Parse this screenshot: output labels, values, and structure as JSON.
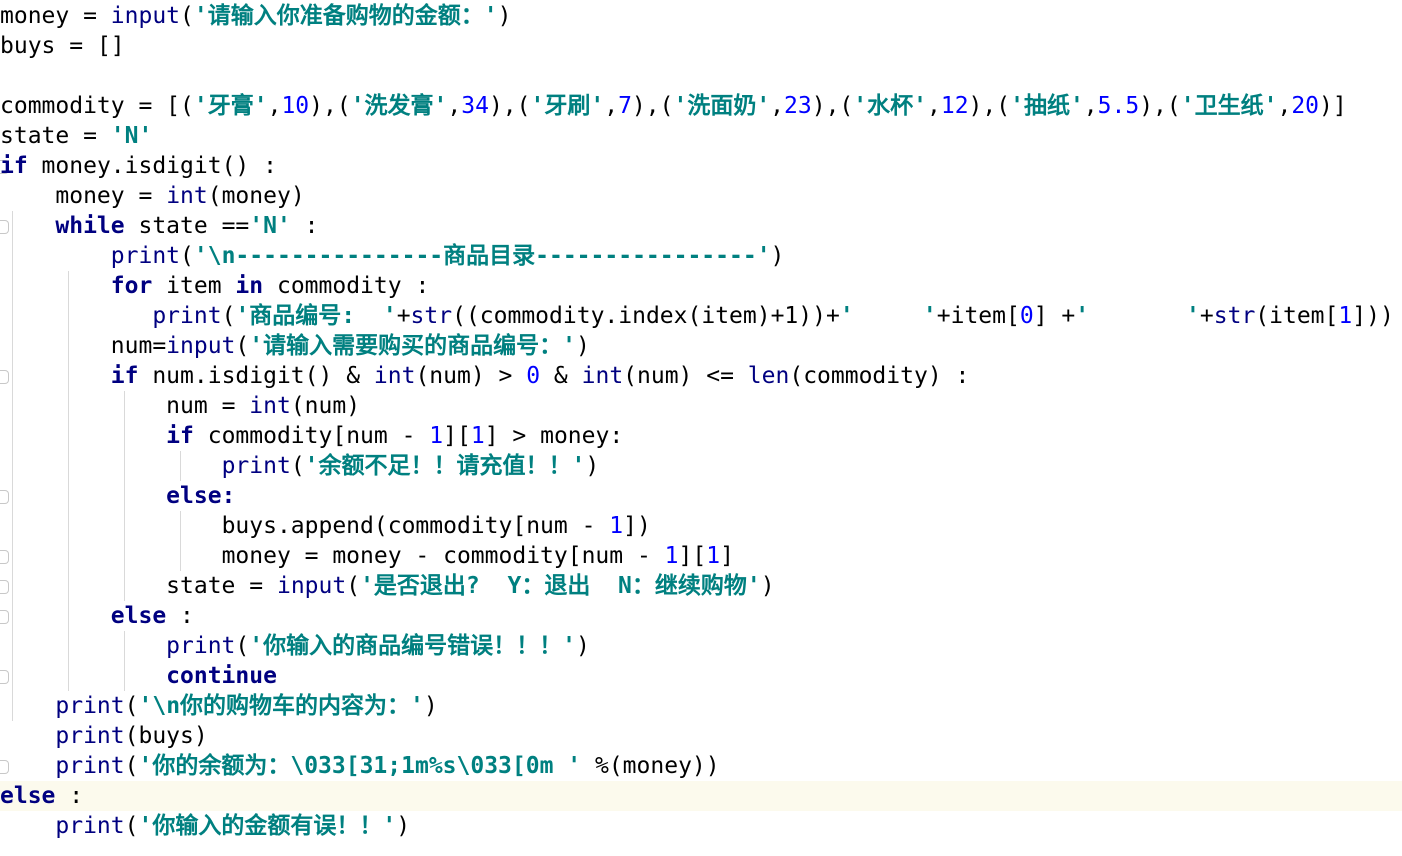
{
  "editor": {
    "language": "python",
    "current_line": 26,
    "colors": {
      "background": "#ffffff",
      "keyword": "#000080",
      "string": "#008080",
      "number": "#0000ff",
      "builtin": "#000080",
      "current_line": "#fcfaed",
      "indent_guide": "#d9d9d9"
    },
    "lines": [
      [
        [
          "id",
          "money"
        ],
        [
          "op",
          " = "
        ],
        [
          "bi",
          "input"
        ],
        [
          "op",
          "("
        ],
        [
          "str",
          "'请输入你准备购物的金额：'"
        ],
        [
          "op",
          ")"
        ]
      ],
      [
        [
          "id",
          "buys"
        ],
        [
          "op",
          " = "
        ],
        [
          "op",
          "[]"
        ]
      ],
      [],
      [
        [
          "id",
          "commodity"
        ],
        [
          "op",
          " = "
        ],
        [
          "op",
          "[("
        ],
        [
          "str",
          "'牙膏'"
        ],
        [
          "op",
          ","
        ],
        [
          "num",
          "10"
        ],
        [
          "op",
          "),("
        ],
        [
          "str",
          "'洗发膏'"
        ],
        [
          "op",
          ","
        ],
        [
          "num",
          "34"
        ],
        [
          "op",
          "),("
        ],
        [
          "str",
          "'牙刷'"
        ],
        [
          "op",
          ","
        ],
        [
          "num",
          "7"
        ],
        [
          "op",
          "),("
        ],
        [
          "str",
          "'洗面奶'"
        ],
        [
          "op",
          ","
        ],
        [
          "num",
          "23"
        ],
        [
          "op",
          "),("
        ],
        [
          "str",
          "'水杯'"
        ],
        [
          "op",
          ","
        ],
        [
          "num",
          "12"
        ],
        [
          "op",
          "),("
        ],
        [
          "str",
          "'抽纸'"
        ],
        [
          "op",
          ","
        ],
        [
          "num",
          "5.5"
        ],
        [
          "op",
          "),("
        ],
        [
          "str",
          "'卫生纸'"
        ],
        [
          "op",
          ","
        ],
        [
          "num",
          "20"
        ],
        [
          "op",
          ")]"
        ]
      ],
      [
        [
          "id",
          "state"
        ],
        [
          "op",
          " = "
        ],
        [
          "str",
          "'N'"
        ]
      ],
      [
        [
          "kw",
          "if"
        ],
        [
          "id",
          " money.isdigit() :"
        ]
      ],
      [
        [
          "ws",
          "    "
        ],
        [
          "id",
          "money"
        ],
        [
          "op",
          " = "
        ],
        [
          "bi",
          "int"
        ],
        [
          "op",
          "(money)"
        ]
      ],
      [
        [
          "ws",
          "    "
        ],
        [
          "kw",
          "while"
        ],
        [
          "id",
          " state =="
        ],
        [
          "str",
          "'N'"
        ],
        [
          "op",
          " :"
        ]
      ],
      [
        [
          "ws",
          "        "
        ],
        [
          "bi",
          "print"
        ],
        [
          "op",
          "("
        ],
        [
          "str",
          "'\\n---------------商品目录----------------'"
        ],
        [
          "op",
          ")"
        ]
      ],
      [
        [
          "ws",
          "        "
        ],
        [
          "kw",
          "for"
        ],
        [
          "id",
          " item "
        ],
        [
          "kw",
          "in"
        ],
        [
          "id",
          " commodity :"
        ]
      ],
      [
        [
          "ws",
          "           "
        ],
        [
          "bi",
          "print"
        ],
        [
          "op",
          "("
        ],
        [
          "str",
          "'商品编号:  '"
        ],
        [
          "op",
          "+"
        ],
        [
          "bi",
          "str"
        ],
        [
          "op",
          "((commodity.index(item)+1))+"
        ],
        [
          "str",
          "'     '"
        ],
        [
          "op",
          "+item["
        ],
        [
          "num",
          "0"
        ],
        [
          "op",
          "] +"
        ],
        [
          "str",
          "'       '"
        ],
        [
          "op",
          "+"
        ],
        [
          "bi",
          "str"
        ],
        [
          "op",
          "(item["
        ],
        [
          "num",
          "1"
        ],
        [
          "op",
          "]))"
        ]
      ],
      [
        [
          "ws",
          "        "
        ],
        [
          "id",
          "num="
        ],
        [
          "bi",
          "input"
        ],
        [
          "op",
          "("
        ],
        [
          "str",
          "'请输入需要购买的商品编号：'"
        ],
        [
          "op",
          ")"
        ]
      ],
      [
        [
          "ws",
          "        "
        ],
        [
          "kw",
          "if"
        ],
        [
          "id",
          " num.isdigit() & "
        ],
        [
          "bi",
          "int"
        ],
        [
          "op",
          "(num) > "
        ],
        [
          "num",
          "0"
        ],
        [
          "op",
          " & "
        ],
        [
          "bi",
          "int"
        ],
        [
          "op",
          "(num) <= "
        ],
        [
          "bi",
          "len"
        ],
        [
          "op",
          "(commodity) :"
        ]
      ],
      [
        [
          "ws",
          "            "
        ],
        [
          "id",
          "num"
        ],
        [
          "op",
          " = "
        ],
        [
          "bi",
          "int"
        ],
        [
          "op",
          "(num)"
        ]
      ],
      [
        [
          "ws",
          "            "
        ],
        [
          "kw",
          "if"
        ],
        [
          "id",
          " commodity[num - "
        ],
        [
          "num",
          "1"
        ],
        [
          "op",
          "]["
        ],
        [
          "num",
          "1"
        ],
        [
          "op",
          "] > money:"
        ]
      ],
      [
        [
          "ws",
          "                "
        ],
        [
          "bi",
          "print"
        ],
        [
          "op",
          "("
        ],
        [
          "str",
          "'余额不足！！请充值！！'"
        ],
        [
          "op",
          ")"
        ]
      ],
      [
        [
          "ws",
          "            "
        ],
        [
          "kw",
          "else:"
        ]
      ],
      [
        [
          "ws",
          "                "
        ],
        [
          "id",
          "buys.append(commodity[num - "
        ],
        [
          "num",
          "1"
        ],
        [
          "op",
          "])"
        ]
      ],
      [
        [
          "ws",
          "                "
        ],
        [
          "id",
          "money = money - commodity[num - "
        ],
        [
          "num",
          "1"
        ],
        [
          "op",
          "]["
        ],
        [
          "num",
          "1"
        ],
        [
          "op",
          "]"
        ]
      ],
      [
        [
          "ws",
          "            "
        ],
        [
          "id",
          "state"
        ],
        [
          "op",
          " = "
        ],
        [
          "bi",
          "input"
        ],
        [
          "op",
          "("
        ],
        [
          "str",
          "'是否退出?  Y：退出  N：继续购物'"
        ],
        [
          "op",
          ")"
        ]
      ],
      [
        [
          "ws",
          "        "
        ],
        [
          "kw",
          "else"
        ],
        [
          "op",
          " :"
        ]
      ],
      [
        [
          "ws",
          "            "
        ],
        [
          "bi",
          "print"
        ],
        [
          "op",
          "("
        ],
        [
          "str",
          "'你输入的商品编号错误！！！'"
        ],
        [
          "op",
          ")"
        ]
      ],
      [
        [
          "ws",
          "            "
        ],
        [
          "kw",
          "continue"
        ]
      ],
      [
        [
          "ws",
          "    "
        ],
        [
          "bi",
          "print"
        ],
        [
          "op",
          "("
        ],
        [
          "str",
          "'\\n你的购物车的内容为：'"
        ],
        [
          "op",
          ")"
        ]
      ],
      [
        [
          "ws",
          "    "
        ],
        [
          "bi",
          "print"
        ],
        [
          "op",
          "(buys)"
        ]
      ],
      [
        [
          "ws",
          "    "
        ],
        [
          "bi",
          "print"
        ],
        [
          "op",
          "("
        ],
        [
          "str",
          "'你的余额为：\\033[31;1m%s\\033[0m '"
        ],
        [
          "op",
          " %(money))"
        ]
      ],
      [
        [
          "kw",
          "else"
        ],
        [
          "op",
          " :"
        ]
      ],
      [
        [
          "ws",
          "    "
        ],
        [
          "bi",
          "print"
        ],
        [
          "op",
          "("
        ],
        [
          "str",
          "'你输入的金额有误！！'"
        ],
        [
          "op",
          ")"
        ]
      ]
    ]
  }
}
